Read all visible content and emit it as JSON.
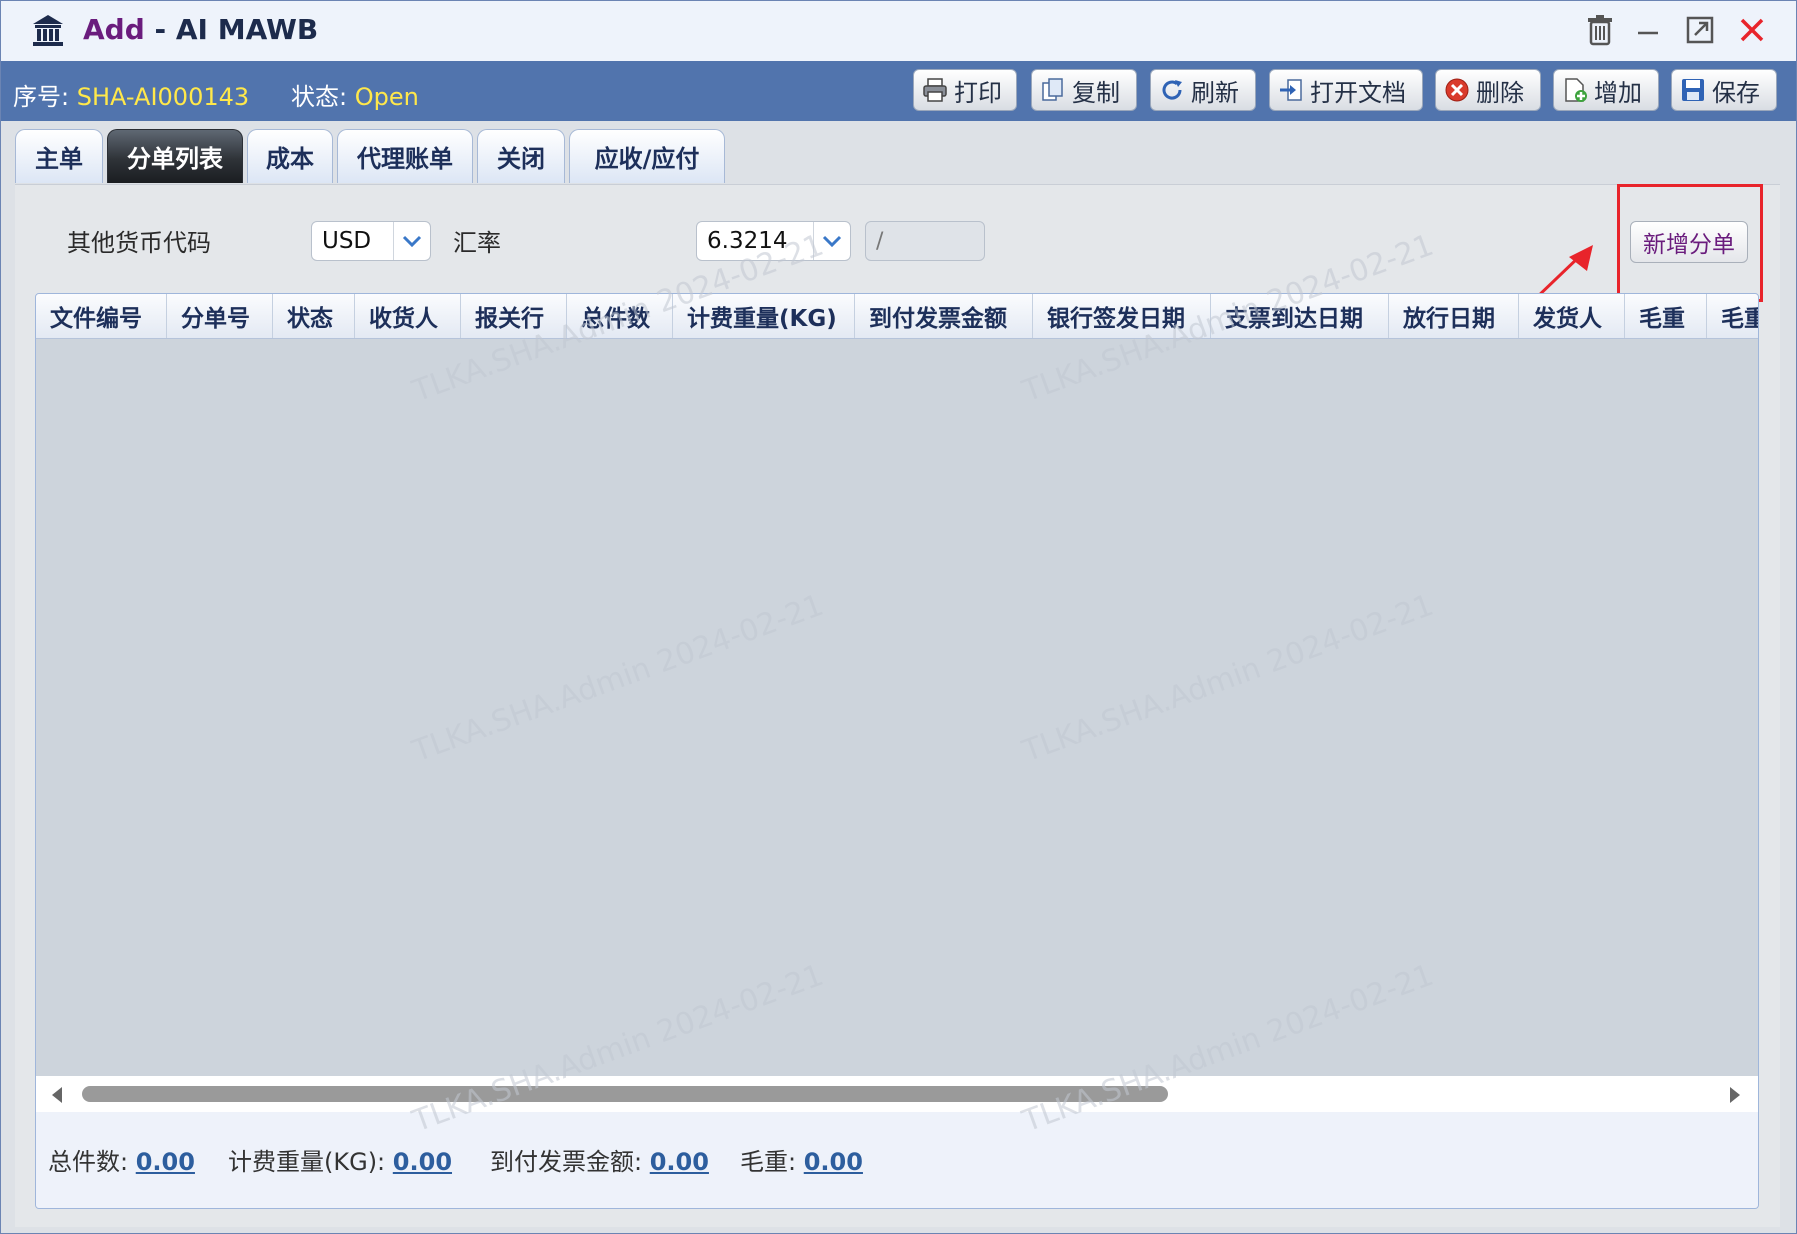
{
  "window": {
    "title_add": "Add",
    "title_sep": " - ",
    "title_name": "AI MAWB"
  },
  "header": {
    "seq_label": "序号:",
    "seq_value": "SHA-AI000143",
    "status_label": "状态:",
    "status_value": "Open"
  },
  "toolbar": {
    "print": "打印",
    "copy": "复制",
    "refresh": "刷新",
    "open_doc": "打开文档",
    "delete": "删除",
    "add": "增加",
    "save": "保存"
  },
  "tabs": [
    {
      "label": "主单",
      "active": false
    },
    {
      "label": "分单列表",
      "active": true
    },
    {
      "label": "成本",
      "active": false
    },
    {
      "label": "代理账单",
      "active": false
    },
    {
      "label": "关闭",
      "active": false
    },
    {
      "label": "应收/应付",
      "active": false
    }
  ],
  "filters": {
    "currency_label": "其他货币代码",
    "currency_value": "USD",
    "rate_label": "汇率",
    "rate_value": "6.3214",
    "rate_extra_placeholder": "/",
    "new_house_button": "新增分单"
  },
  "grid": {
    "columns": [
      "文件编号",
      "分单号",
      "状态",
      "收货人",
      "报关行",
      "总件数",
      "计费重量(KG)",
      "到付发票金额",
      "银行签发日期",
      "支票到达日期",
      "放行日期",
      "发货人",
      "毛重",
      "毛重"
    ],
    "rows": []
  },
  "footer": {
    "total_pieces_label": "总件数:",
    "total_pieces_value": "0.00",
    "charge_weight_label": "计费重量(KG):",
    "charge_weight_value": "0.00",
    "cod_amount_label": "到付发票金额:",
    "cod_amount_value": "0.00",
    "gross_weight_label": "毛重:",
    "gross_weight_value": "0.00"
  },
  "watermark": "TLKA.SHA.Admin 2024-02-21",
  "colors": {
    "header_bg": "#5174ad",
    "header_value": "#ffe84a",
    "title_accent": "#6a1c7d",
    "highlight": "#e8242b"
  }
}
